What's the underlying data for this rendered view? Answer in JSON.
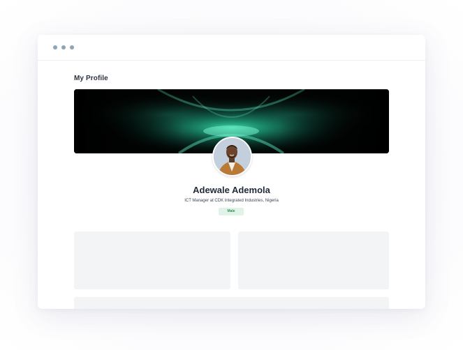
{
  "window": {
    "controls": [
      "dot-icon",
      "dot-icon",
      "dot-icon"
    ]
  },
  "page": {
    "title": "My Profile"
  },
  "profile": {
    "name": "Adewale Ademola",
    "subtitle": "ICT Manager at CDK Integrated Industries, Nigeria",
    "badge": "Male"
  },
  "colors": {
    "accent_green": "#2ecc9a",
    "badge_bg": "#dff3e6",
    "badge_text": "#3e8a5a",
    "card_bg": "#f3f4f6",
    "window_dot": "#8fa3b7"
  }
}
